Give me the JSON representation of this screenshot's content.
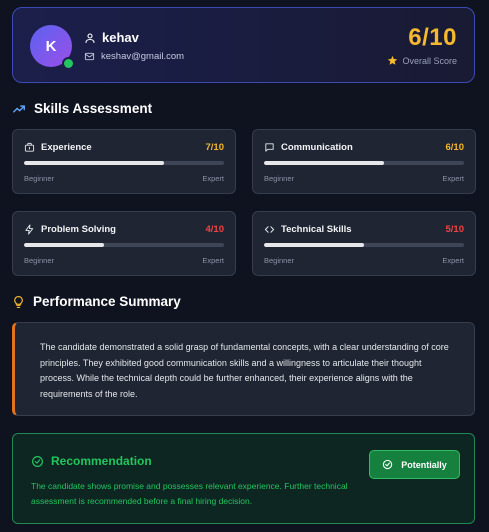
{
  "profile": {
    "initial": "K",
    "name": "kehav",
    "email": "keshav@gmail.com",
    "score": "6/10",
    "score_label": "Overall Score"
  },
  "skills_section": {
    "title": "Skills Assessment",
    "min_label": "Beginner",
    "max_label": "Expert",
    "items": [
      {
        "label": "Experience",
        "score": "7/10",
        "value": 7,
        "max": 10,
        "color": "#f5b82e",
        "icon": "briefcase-icon"
      },
      {
        "label": "Communication",
        "score": "6/10",
        "value": 6,
        "max": 10,
        "color": "#f5b82e",
        "icon": "message-icon"
      },
      {
        "label": "Problem Solving",
        "score": "4/10",
        "value": 4,
        "max": 10,
        "color": "#ef4444",
        "icon": "zap-icon"
      },
      {
        "label": "Technical Skills",
        "score": "5/10",
        "value": 5,
        "max": 10,
        "color": "#ef4444",
        "icon": "code-icon"
      }
    ]
  },
  "summary_section": {
    "title": "Performance Summary",
    "text": "The candidate demonstrated a solid grasp of fundamental concepts, with a clear understanding of core principles. They exhibited good communication skills and a willingness to articulate their thought process. While the technical depth could be further enhanced, their experience aligns with the requirements of the role."
  },
  "recommendation": {
    "title": "Recommendation",
    "text": "The candidate shows promise and possesses relevant experience. Further technical assessment is recommended before a final hiring decision.",
    "badge_label": "Potentially"
  },
  "colors": {
    "accent_gold": "#f5b82e",
    "accent_red": "#ef4444",
    "accent_green": "#22c55e",
    "summary_border": "#e2751c"
  }
}
